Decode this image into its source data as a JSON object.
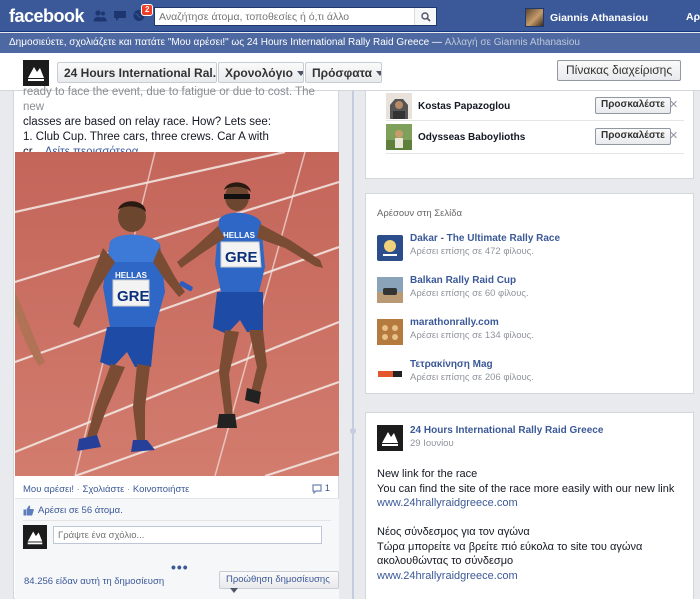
{
  "topbar": {
    "logo": "facebook",
    "notification_count": "2",
    "search_placeholder": "Αναζήτησε άτομα, τοποθεσίες ή ό,τι άλλο",
    "user_name": "Giannis Athanasiou",
    "home_label": "Αρ"
  },
  "notice": {
    "text": "Δημοσιεύετε, σχολιάζετε και πατάτε \"Μου αρέσει!\" ως 24 Hours International Rally Raid Greece — ",
    "switch_link": "Αλλαγή σε Giannis Athanasiou"
  },
  "pagebar": {
    "page_name_button": "24 Hours International Ral...",
    "timeline_button": "Χρονολόγιο",
    "recent_button": "Πρόσφατα",
    "manage_button": "Πίνακας διαχείρισης"
  },
  "post": {
    "line1": "ready to face the event, due to fatigue or due to cost. The new",
    "line2": "classes are based on relay race. How? Lets see:",
    "line3": "1. Club Cup. Three cars, three crews. Car A with",
    "line4_prefix": "cr... ",
    "see_more": "Δείτε περισσότερα",
    "jersey_text": "HELLAS",
    "bib_text": "GRE",
    "actions": {
      "like": "Μου αρέσει!",
      "comment": "Σχολιάστε",
      "share": "Κοινοποιήστε"
    },
    "comment_count": "1",
    "likes_text": "Αρέσει σε 56 άτομα.",
    "comment_placeholder": "Γράψτε ένα σχόλιο...",
    "more_dots": "•••",
    "views_text": "84.256 είδαν αυτή τη δημοσίευση",
    "promote_button": "Προώθηση δημοσίευσης"
  },
  "invites": {
    "button_label": "Προσκαλέστε",
    "people": [
      {
        "name": "Kostas Papazoglou"
      },
      {
        "name": "Odysseas Baboylioths"
      }
    ]
  },
  "likes_card": {
    "title": "Αρέσουν στη Σελίδα",
    "pages": [
      {
        "name": "Dakar - The Ultimate Rally Race",
        "sub": "Αρέσει επίσης σε 472 φίλους."
      },
      {
        "name": "Balkan Rally Raid Cup",
        "sub": "Αρέσει επίσης σε 60 φίλους."
      },
      {
        "name": "marathonrally.com",
        "sub": "Αρέσει επίσης σε 134 φίλους."
      },
      {
        "name": "Τετρακίνηση Mag",
        "sub": "Αρέσει επίσης σε 206 φίλους."
      }
    ]
  },
  "feed_post": {
    "page_name": "24 Hours International Rally Raid Greece",
    "date": "29 Ιουνίου",
    "l1": "New link for the race",
    "l2": "You can find the site of the race more easily with our new link",
    "l3": "www.24hrallyraidgreece.com",
    "l4": "Νέος σύνδεσμος για τον αγώνα",
    "l5": "Τώρα μπορείτε να βρείτε πιό εύκολα το site του αγώνα",
    "l6": "ακολουθώντας το σύνδεσμο",
    "l7": "www.24hrallyraidgreece.com"
  },
  "colors": {
    "brand_blue": "#3b5998",
    "notice_blue": "#4e69a2",
    "link_blue": "#3b5998",
    "track_red": "#c9695c",
    "jersey_blue": "#2a5fb8"
  }
}
